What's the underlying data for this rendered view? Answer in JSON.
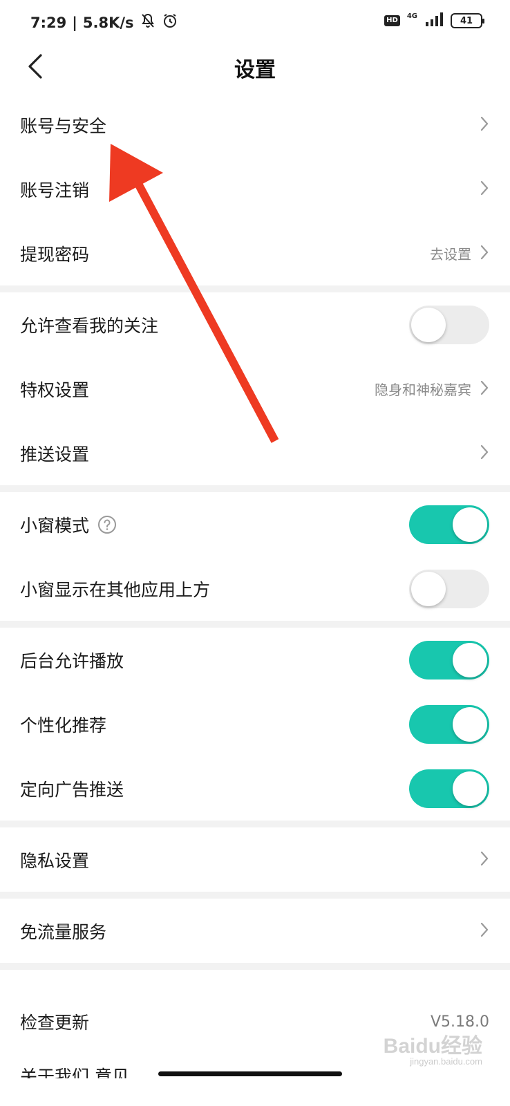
{
  "status_bar": {
    "time": "7:29",
    "separator": "|",
    "net_speed": "5.8K/s",
    "hd": "HD",
    "network": "4G",
    "battery": "41"
  },
  "nav": {
    "title": "设置"
  },
  "groups": [
    {
      "rows": [
        {
          "label": "账号与安全",
          "value": ""
        },
        {
          "label": "账号注销",
          "value": ""
        },
        {
          "label": "提现密码",
          "value": "去设置"
        }
      ]
    },
    {
      "rows": [
        {
          "label": "允许查看我的关注",
          "toggle": false
        },
        {
          "label": "特权设置",
          "value": "隐身和神秘嘉宾"
        },
        {
          "label": "推送设置",
          "value": ""
        }
      ]
    },
    {
      "rows": [
        {
          "label": "小窗模式",
          "toggle": true
        },
        {
          "label": "小窗显示在其他应用上方",
          "toggle": false
        }
      ]
    },
    {
      "rows": [
        {
          "label": "后台允许播放",
          "toggle": true
        },
        {
          "label": "个性化推荐",
          "toggle": true
        },
        {
          "label": "定向广告推送",
          "toggle": true
        }
      ]
    },
    {
      "rows": [
        {
          "label": "隐私设置",
          "value": ""
        }
      ]
    },
    {
      "rows": [
        {
          "label": "免流量服务",
          "value": ""
        }
      ]
    },
    {
      "rows": [
        {
          "label": "检查更新",
          "value": "V5.18.0"
        }
      ]
    }
  ],
  "partial_row_label": "关于我们 意见",
  "watermark": {
    "brand": "Baidu经验",
    "url": "jingyan.baidu.com"
  },
  "colors": {
    "toggle_on": "#18c7ae",
    "toggle_off": "#ececec",
    "annotation_arrow": "#ee3a22",
    "section_gap": "#f2f2f2"
  },
  "icons": [
    "back-icon",
    "bell-off-icon",
    "alarm-icon",
    "signal-icon",
    "chevron-right-icon",
    "help-icon"
  ]
}
